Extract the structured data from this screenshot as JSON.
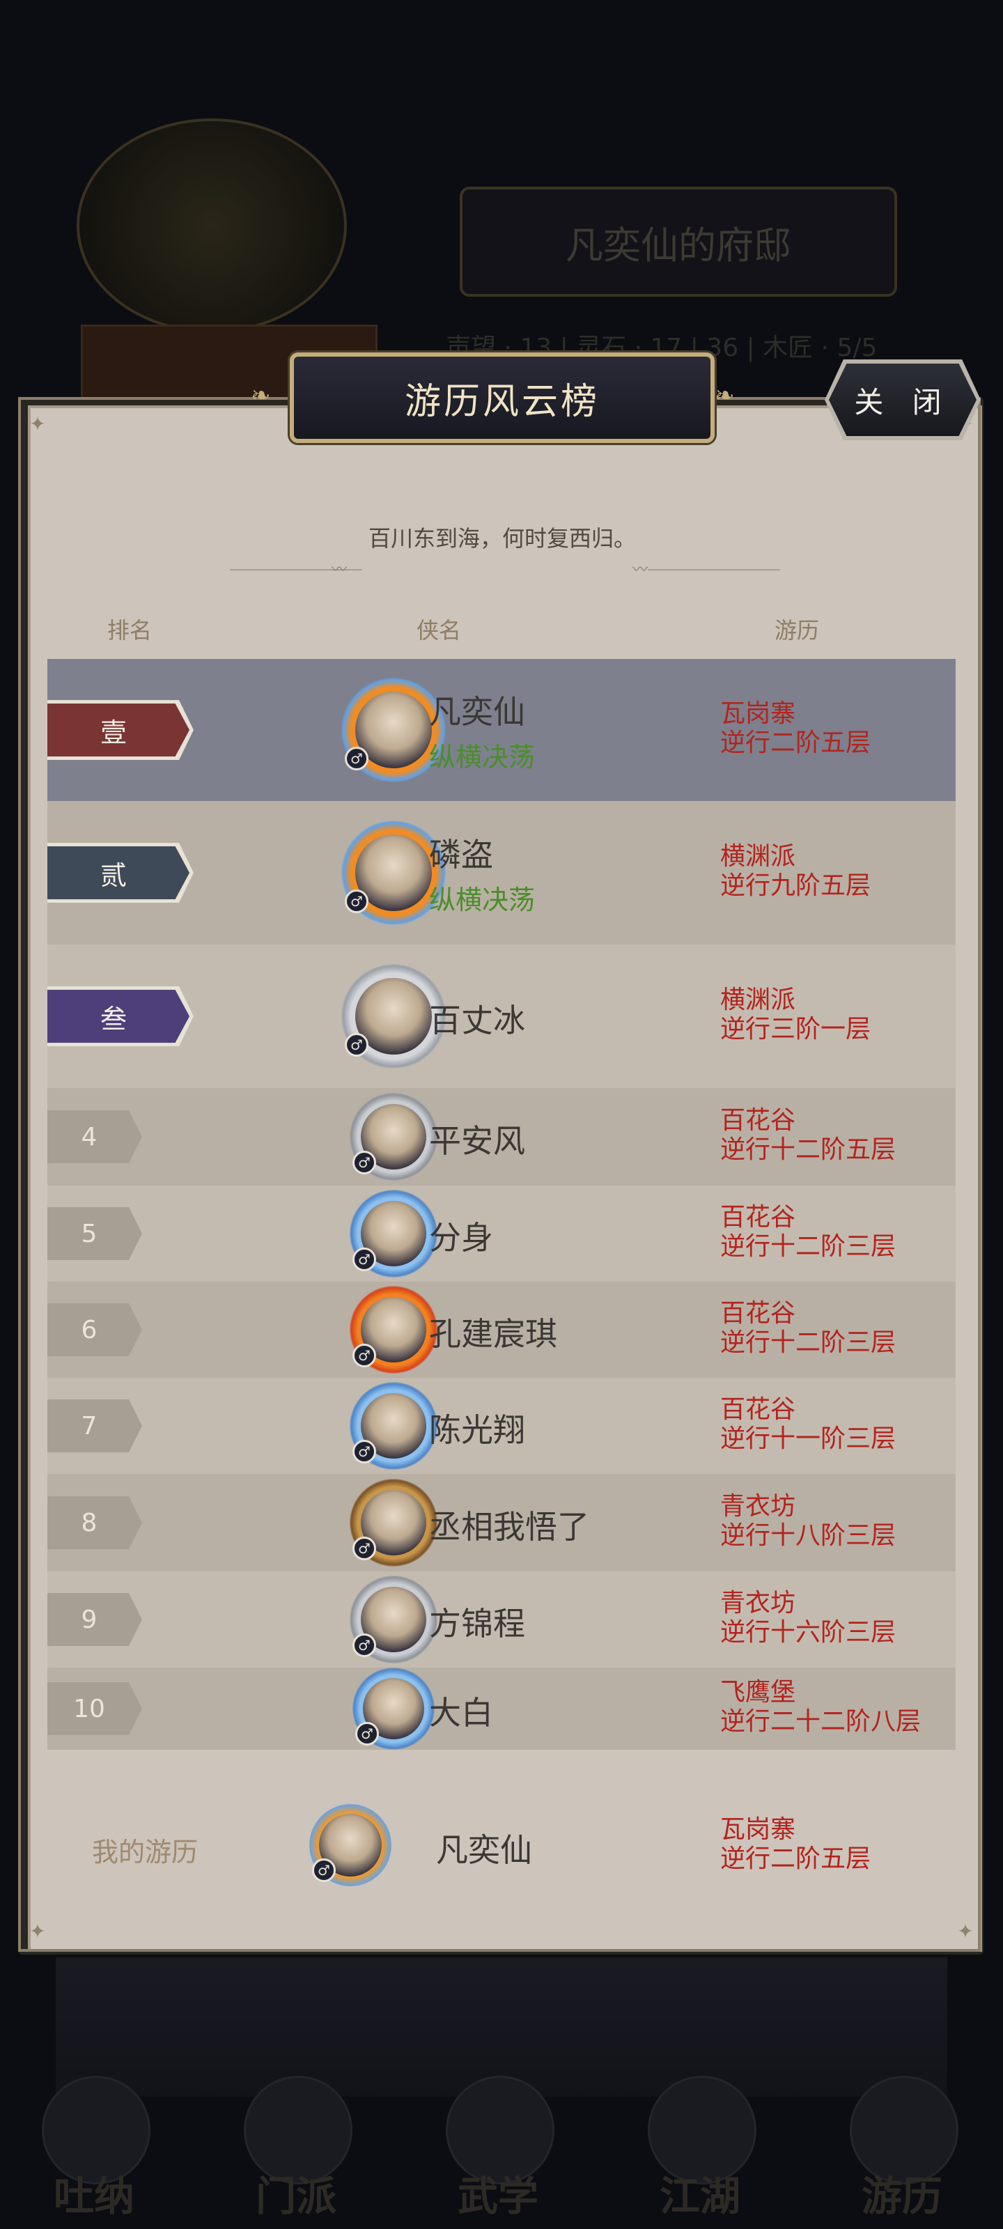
{
  "background": {
    "residence_title": "凡奕仙的府邸",
    "info_line": "声望 · 13 | 灵石 · 17 | 36 | 木匠 · 5/5",
    "tabs": [
      "吐纳",
      "门派",
      "武学",
      "江湖",
      "游历"
    ]
  },
  "modal": {
    "title": "游历风云榜",
    "close_label": "关 闭",
    "subtitle": "百川东到海，何时复西归。",
    "columns": {
      "rank": "排名",
      "name": "侠名",
      "journey": "游历"
    }
  },
  "rankings": [
    {
      "rank": "壹",
      "name": "凡奕仙",
      "tag": "纵横决荡",
      "sect": "瓦岗寨",
      "progress": "逆行二阶五层",
      "ring": "fire-blue"
    },
    {
      "rank": "贰",
      "name": "磷盗",
      "tag": "纵横决荡",
      "sect": "横渊派",
      "progress": "逆行九阶五层",
      "ring": "fire-blue"
    },
    {
      "rank": "叁",
      "name": "百丈冰",
      "tag": "",
      "sect": "横渊派",
      "progress": "逆行三阶一层",
      "ring": "silver-lotus"
    },
    {
      "rank": "4",
      "name": "平安风",
      "tag": "",
      "sect": "百花谷",
      "progress": "逆行十二阶五层",
      "ring": "silver"
    },
    {
      "rank": "5",
      "name": "分身",
      "tag": "",
      "sect": "百花谷",
      "progress": "逆行十二阶三层",
      "ring": "blue"
    },
    {
      "rank": "6",
      "name": "孔建宸琪",
      "tag": "",
      "sect": "百花谷",
      "progress": "逆行十二阶三层",
      "ring": "fire"
    },
    {
      "rank": "7",
      "name": "陈光翔",
      "tag": "",
      "sect": "百花谷",
      "progress": "逆行十一阶三层",
      "ring": "blue"
    },
    {
      "rank": "8",
      "name": "丞相我悟了",
      "tag": "",
      "sect": "青衣坊",
      "progress": "逆行十八阶三层",
      "ring": "gold-dragon"
    },
    {
      "rank": "9",
      "name": "方锦程",
      "tag": "",
      "sect": "青衣坊",
      "progress": "逆行十六阶三层",
      "ring": "silver"
    },
    {
      "rank": "10",
      "name": "大白",
      "tag": "",
      "sect": "飞鹰堡",
      "progress": "逆行二十二阶八层",
      "ring": "blue"
    }
  ],
  "my_entry": {
    "label": "我的游历",
    "name": "凡奕仙",
    "sect": "瓦岗寨",
    "progress": "逆行二阶五层"
  },
  "colors": {
    "rank1_badge": "#7a3433",
    "rank2_badge": "#3e4a57",
    "rank3_badge": "#4e3f7a",
    "name_text": "#3b3734",
    "tag_text": "#4a8e2a",
    "location_text": "#b2241d",
    "header_text": "#8e7d67",
    "highlight_row": "#7e808d"
  }
}
